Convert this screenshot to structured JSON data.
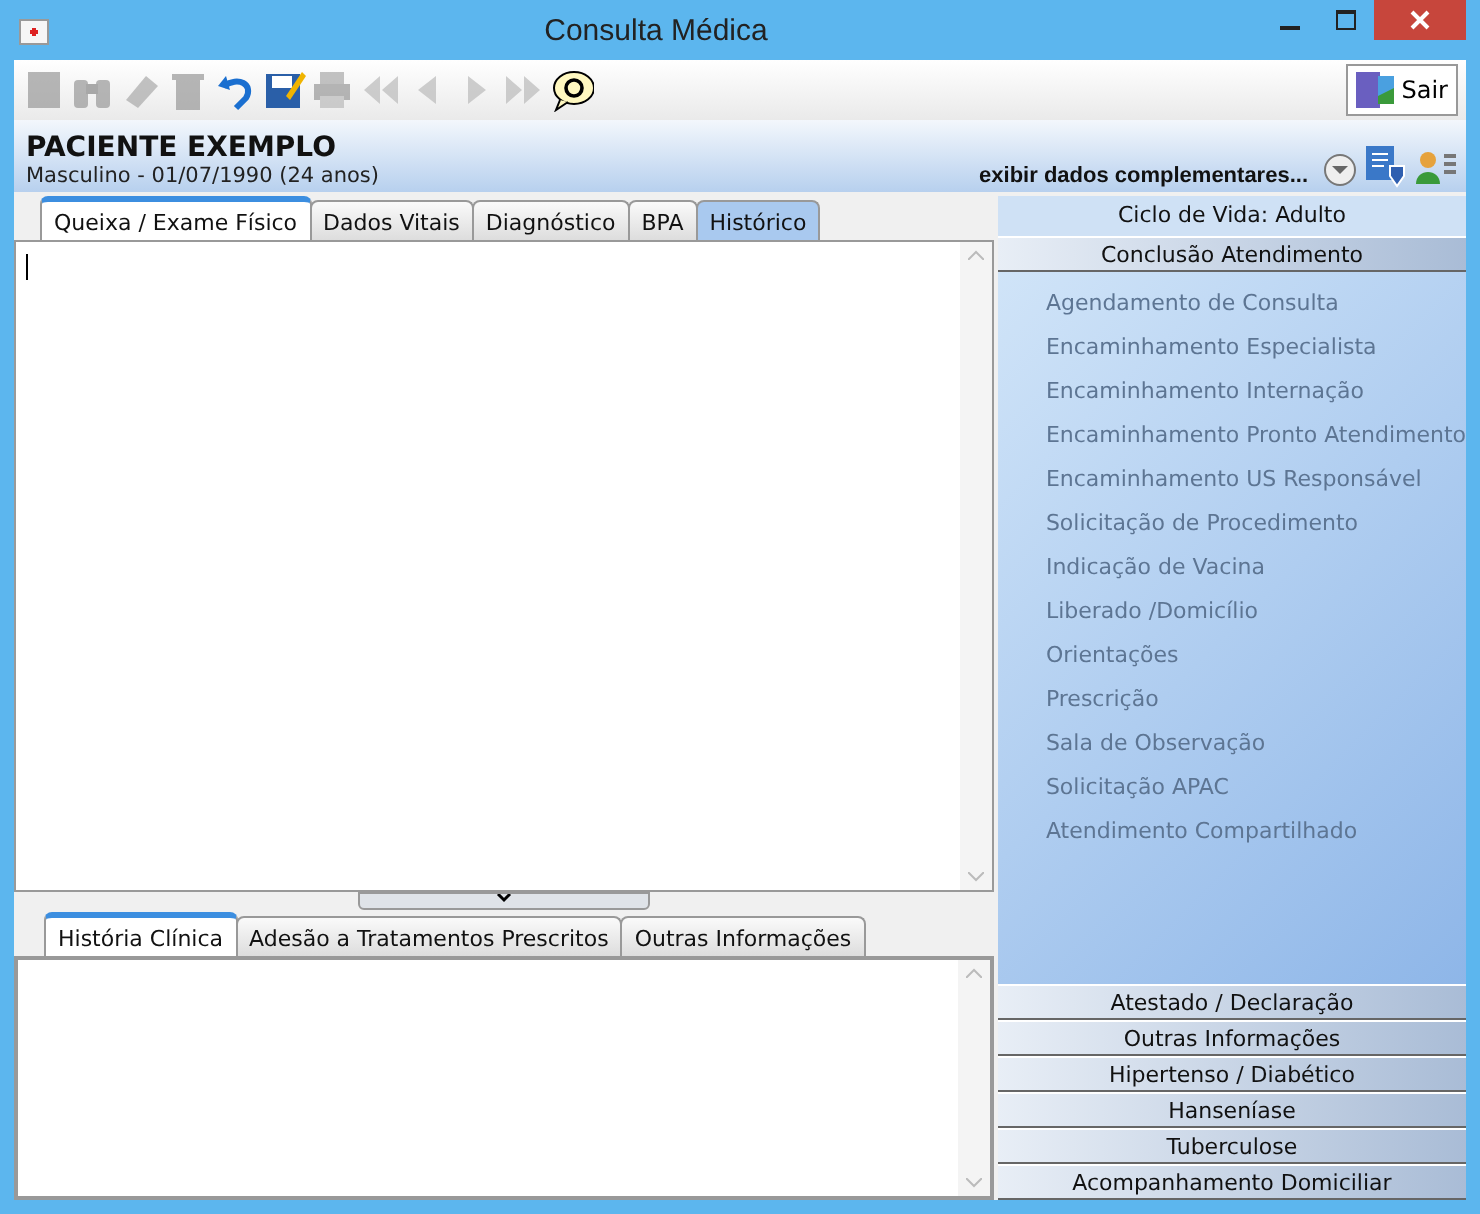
{
  "window": {
    "title": "Consulta Médica"
  },
  "toolbar": [
    {
      "kind": "page",
      "disabled": true
    },
    {
      "kind": "binoculars",
      "disabled": true
    },
    {
      "kind": "eraser",
      "disabled": true
    },
    {
      "kind": "trash",
      "disabled": true
    },
    {
      "kind": "undo",
      "disabled": false
    },
    {
      "kind": "save",
      "disabled": false
    },
    {
      "kind": "printer",
      "disabled": true
    },
    {
      "kind": "first",
      "disabled": true
    },
    {
      "kind": "prev",
      "disabled": true
    },
    {
      "kind": "next",
      "disabled": true
    },
    {
      "kind": "last",
      "disabled": true
    },
    {
      "kind": "help",
      "disabled": false
    }
  ],
  "exit_button": "Sair",
  "patient": {
    "name": "PACIENTE EXEMPLO",
    "details": "Masculino - 01/07/1990 (24 anos)",
    "more_link": "exibir dados complementares..."
  },
  "tabs": [
    {
      "label": "Queixa / Exame Físico",
      "selected": true,
      "highlighted": false
    },
    {
      "label": "Dados Vitais",
      "selected": false,
      "highlighted": false
    },
    {
      "label": "Diagnóstico",
      "selected": false,
      "highlighted": false
    },
    {
      "label": "BPA",
      "selected": false,
      "highlighted": false
    },
    {
      "label": "Histórico",
      "selected": false,
      "highlighted": true
    }
  ],
  "lower_tabs": [
    {
      "label": "História Clínica",
      "selected": true
    },
    {
      "label": "Adesão a Tratamentos Prescritos",
      "selected": false
    },
    {
      "label": "Outras Informações",
      "selected": false
    }
  ],
  "side": {
    "life_cycle": "Ciclo de Vida: Adulto",
    "section": "Conclusão Atendimento",
    "items": [
      {
        "label": "Agendamento de Consulta",
        "disabled": true
      },
      {
        "label": "Encaminhamento Especialista",
        "disabled": true
      },
      {
        "label": "Encaminhamento Internação",
        "disabled": true
      },
      {
        "label": "Encaminhamento Pronto Atendimento",
        "disabled": true
      },
      {
        "label": "Encaminhamento US Responsável",
        "disabled": true
      },
      {
        "label": "Solicitação de Procedimento",
        "disabled": true
      },
      {
        "label": "Indicação de Vacina",
        "disabled": true
      },
      {
        "label": "Liberado /Domicílio",
        "disabled": true
      },
      {
        "label": "Orientações",
        "disabled": true
      },
      {
        "label": "Prescrição",
        "disabled": true
      },
      {
        "label": "Sala de Observação",
        "disabled": true
      },
      {
        "label": "Solicitação APAC",
        "disabled": true
      },
      {
        "label": "Atendimento Compartilhado",
        "disabled": true
      }
    ],
    "sections": [
      "Atestado / Declaração",
      "Outras Informações",
      "Hipertenso / Diabético",
      "Hanseníase",
      "Tuberculose",
      "Acompanhamento Domiciliar"
    ]
  }
}
